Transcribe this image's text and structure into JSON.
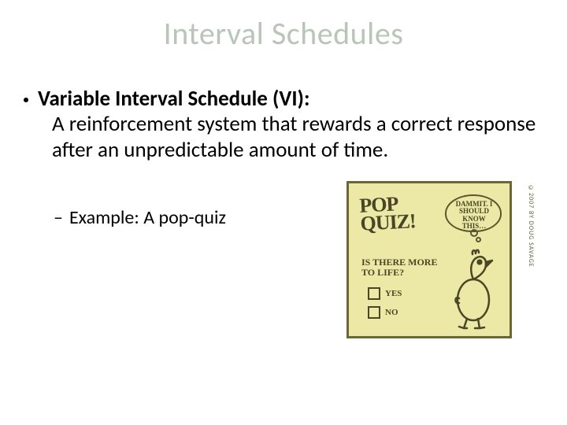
{
  "title": "Interval Schedules",
  "bullet1": {
    "term": "Variable Interval Schedule (VI):",
    "description": "A reinforcement system that rewards a correct response after an unpredictable amount of time."
  },
  "bullet2": {
    "dash": "–",
    "text": "Example: A pop-quiz"
  },
  "figure": {
    "headline_line1": "POP",
    "headline_line2": "QUIZ!",
    "thought": "DAMMIT. I SHOULD KNOW THIS…",
    "question_line1": "IS THERE MORE",
    "question_line2": "TO LIFE?",
    "option_yes": "YES",
    "option_no": "NO",
    "attribution": "©2007 BY DOUG SAVAGE"
  }
}
